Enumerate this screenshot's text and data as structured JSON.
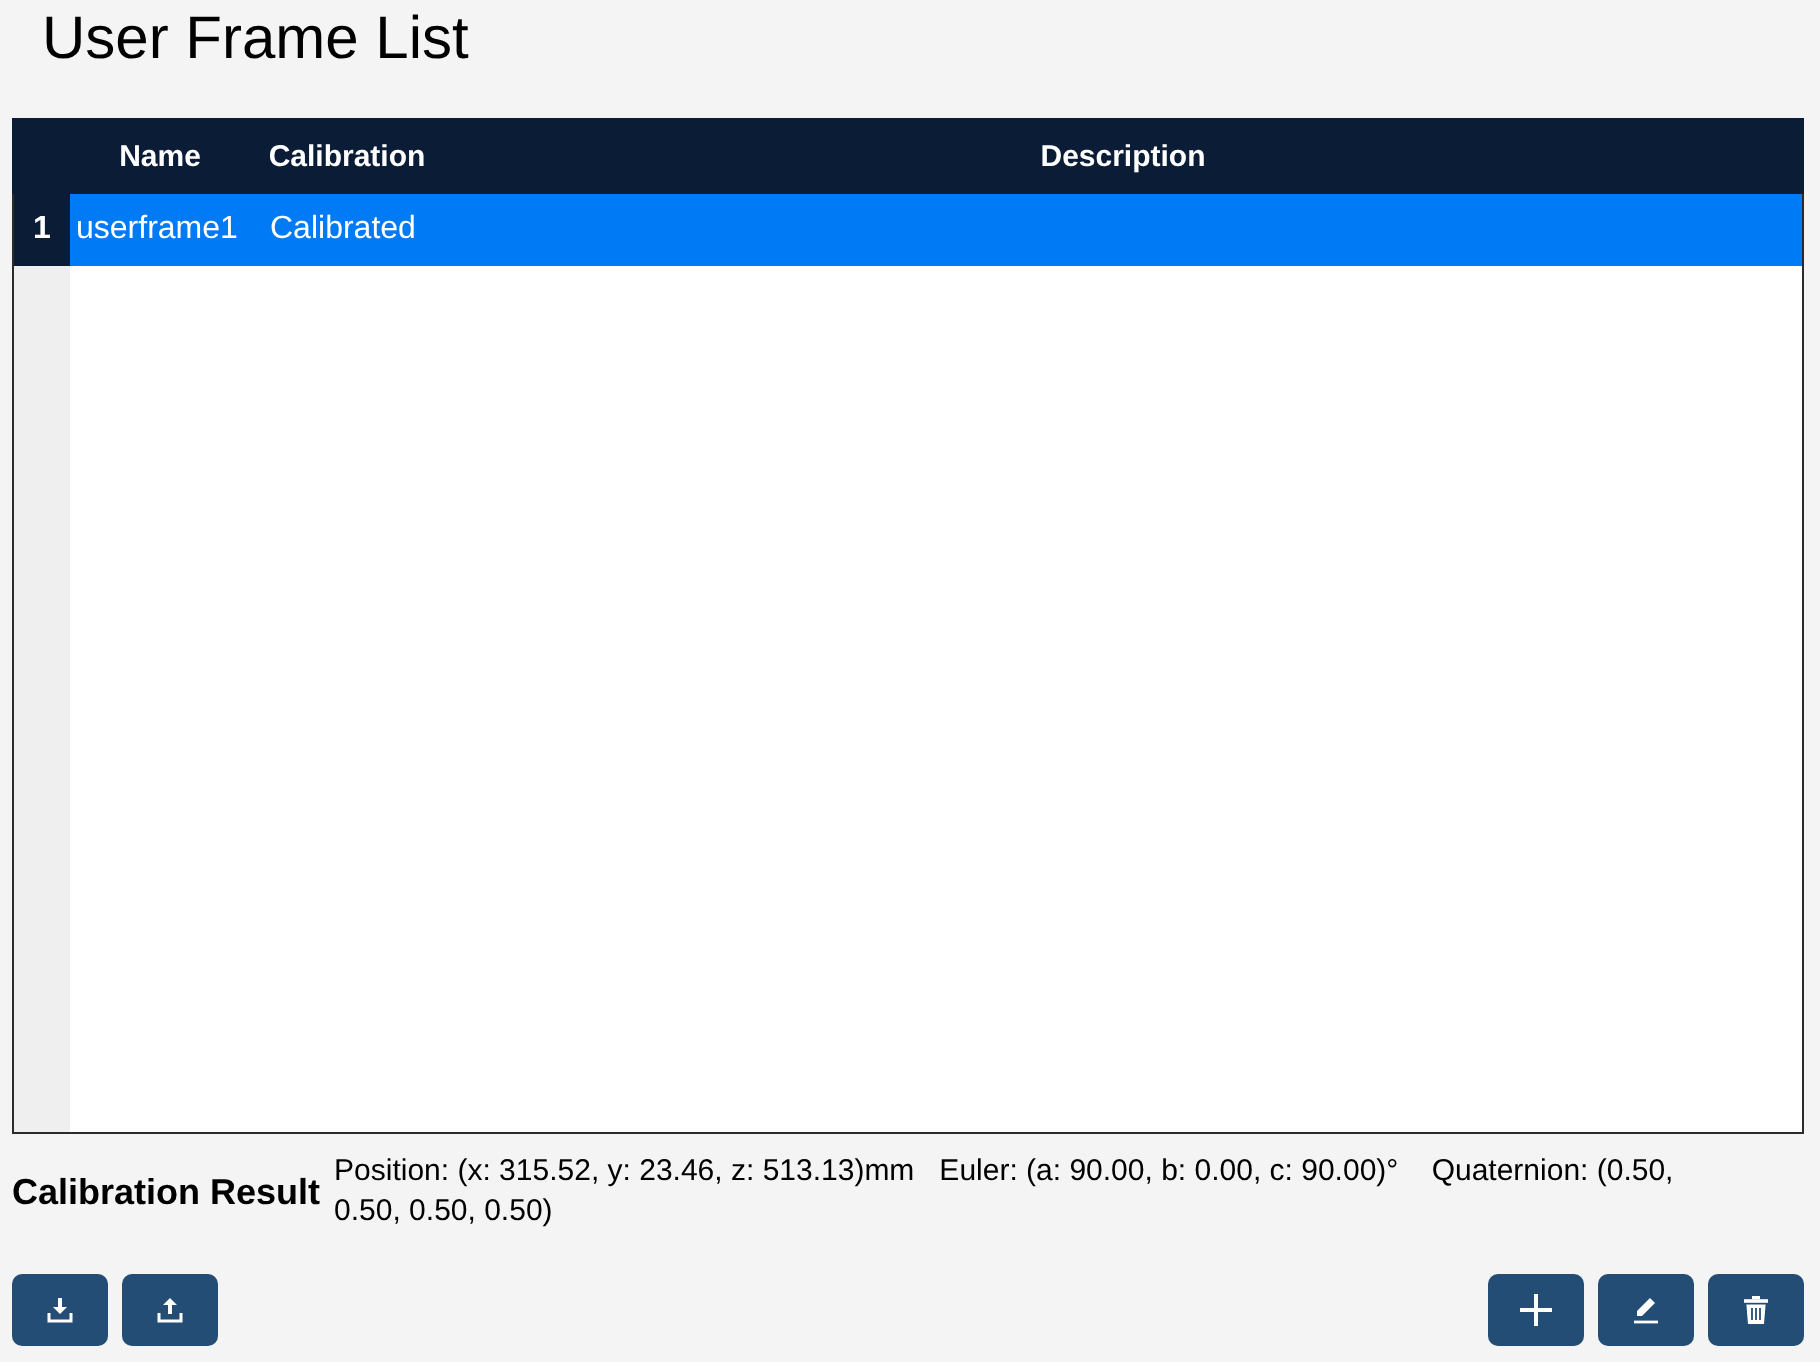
{
  "title": "User Frame List",
  "table": {
    "columns": [
      "Name",
      "Calibration",
      "Description"
    ],
    "rows": [
      {
        "index": "1",
        "name": "userframe1",
        "calibration": "Calibrated",
        "selected": true
      }
    ]
  },
  "calibration_result": {
    "label": "Calibration Result",
    "text": "Position: (x: 315.52, y: 23.46, z: 513.13)mm   Euler: (a: 90.00, b: 0.00, c: 90.00)°    Quaternion: (0.50, 0.50, 0.50, 0.50)"
  },
  "left_buttons": [
    {
      "kind": "import"
    },
    {
      "kind": "export"
    }
  ],
  "right_buttons": [
    {
      "kind": "add"
    },
    {
      "kind": "edit"
    },
    {
      "kind": "delete"
    }
  ]
}
